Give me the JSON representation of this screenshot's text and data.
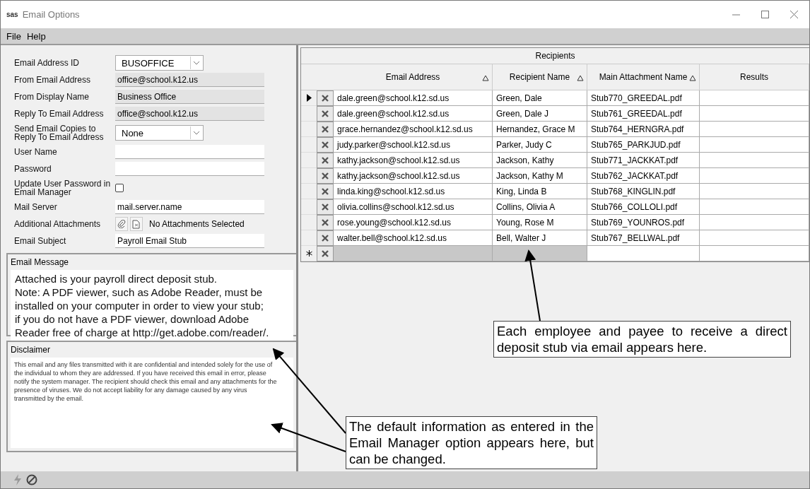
{
  "window": {
    "app_icon": "sas",
    "title": "Email Options"
  },
  "menu": [
    {
      "label": "File"
    },
    {
      "label": "Help"
    }
  ],
  "form": [
    {
      "kind": "dropdown",
      "label": "Email Address ID",
      "value": "BUSOFFICE"
    },
    {
      "kind": "readonly",
      "label": "From Email Address",
      "value": "office@school.k12.us"
    },
    {
      "kind": "readonly",
      "label": "From Display Name",
      "value": "Business Office"
    },
    {
      "kind": "readonly",
      "label": "Reply To Email Address",
      "value": "office@school.k12.us"
    },
    {
      "kind": "dropdown",
      "label": "Send Email Copies to Reply To Email Address",
      "value": "None"
    },
    {
      "kind": "text",
      "label": "User Name"
    },
    {
      "kind": "text",
      "label": "Password"
    },
    {
      "kind": "checkbox",
      "label": "Update User Password in Email Manager",
      "checked": false
    },
    {
      "kind": "text",
      "label": "Mail Server",
      "value": "mail.server.name"
    },
    {
      "kind": "attachments",
      "label": "Additional Attachments",
      "value": "No Attachments Selected"
    },
    {
      "kind": "text",
      "label": "Email Subject",
      "value": "Payroll Email Stub"
    }
  ],
  "message": {
    "title": "Email Message",
    "lines": [
      "Attached is your payroll direct deposit stub.",
      "Note:  A PDF viewer, such as Adobe Reader, must be",
      "installed on your computer in order to view your stub;",
      "if you do not have a PDF viewer, download Adobe",
      "Reader free of charge at http://get.adobe.com/reader/."
    ]
  },
  "disclaimer": {
    "title": "Disclaimer",
    "lines": [
      "This email and any files transmitted with it are confidential and intended solely for the use of",
      "the individual to whom they are addressed.  If you have received this email in error, please",
      "notify the system manager.  The recipient should check this email and any attachments for the",
      "presence of viruses.  We do not accept liability for any damage caused by any virus",
      "transmitted by the email."
    ]
  },
  "grid": {
    "title": "Recipients",
    "columns": [
      {
        "label": "Email Address",
        "sortable": true
      },
      {
        "label": "Recipient Name",
        "sortable": true
      },
      {
        "label": "Main Attachment Name",
        "sortable": true
      },
      {
        "label": "Results",
        "sortable": false
      }
    ],
    "rows": [
      {
        "kind": "data",
        "selected": true,
        "cells": [
          "dale.green@school.k12.sd.us",
          "Green, Dale",
          "Stub770_GREEDAL.pdf"
        ]
      },
      {
        "kind": "data",
        "selected": false,
        "cells": [
          "dale.green@school.k12.sd.us",
          "Green, Dale J",
          "Stub761_GREEDAL.pdf"
        ]
      },
      {
        "kind": "data",
        "selected": false,
        "cells": [
          "grace.hernandez@school.k12.sd.us",
          "Hernandez, Grace M",
          "Stub764_HERNGRA.pdf"
        ]
      },
      {
        "kind": "data",
        "selected": false,
        "cells": [
          "judy.parker@school.k12.sd.us",
          "Parker, Judy C",
          "Stub765_PARKJUD.pdf"
        ]
      },
      {
        "kind": "data",
        "selected": false,
        "cells": [
          "kathy.jackson@school.k12.sd.us",
          "Jackson, Kathy",
          "Stub771_JACKKAT.pdf"
        ]
      },
      {
        "kind": "data",
        "selected": false,
        "cells": [
          "kathy.jackson@school.k12.sd.us",
          "Jackson, Kathy M",
          "Stub762_JACKKAT.pdf"
        ]
      },
      {
        "kind": "data",
        "selected": false,
        "cells": [
          "linda.king@school.k12.sd.us",
          "King, Linda B",
          "Stub768_KINGLIN.pdf"
        ]
      },
      {
        "kind": "data",
        "selected": false,
        "cells": [
          "olivia.collins@school.k12.sd.us",
          "Collins, Olivia A",
          "Stub766_COLLOLI.pdf"
        ]
      },
      {
        "kind": "data",
        "selected": false,
        "cells": [
          "rose.young@school.k12.sd.us",
          "Young, Rose M",
          "Stub769_YOUNROS.pdf"
        ]
      },
      {
        "kind": "data",
        "selected": false,
        "cells": [
          "walter.bell@school.k12.sd.us",
          "Bell, Walter J",
          "Stub767_BELLWAL.pdf"
        ]
      },
      {
        "kind": "new",
        "cells": []
      }
    ]
  },
  "callouts": [
    {
      "text": "Each employee and payee to receive a direct deposit stub via email appears here."
    },
    {
      "text": "The default information as entered in the Email Manager option appears here, but can be changed."
    }
  ]
}
